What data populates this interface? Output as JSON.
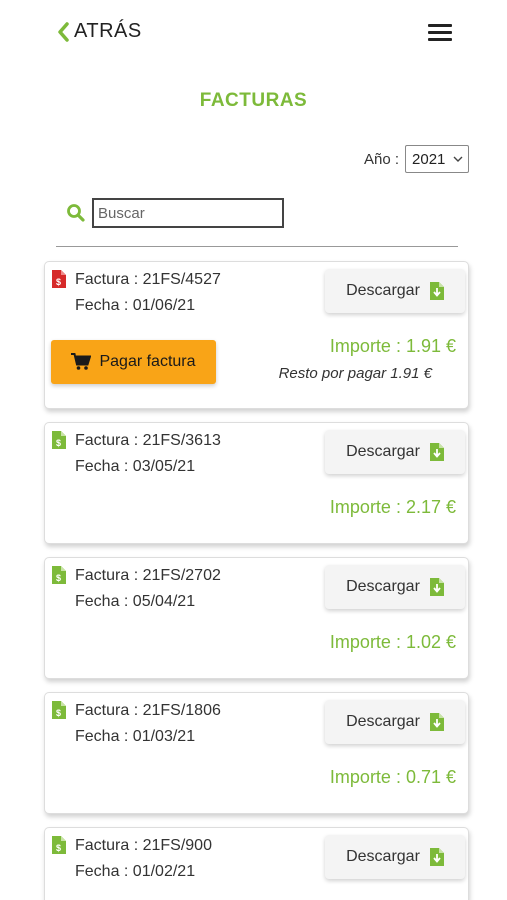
{
  "header": {
    "back_label": "ATRÁS"
  },
  "page_title": "FACTURAS",
  "year_filter": {
    "label": "Año :",
    "selected": "2021"
  },
  "search": {
    "placeholder": "Buscar"
  },
  "colors": {
    "accent_green": "#7dba3a",
    "pay_orange": "#f9a417",
    "unpaid_icon_red": "#d62a2a"
  },
  "invoices": [
    {
      "factura": "Factura : 21FS/4527",
      "fecha": "Fecha : 01/06/21",
      "download_label": "Descargar",
      "importe": "Importe : 1.91 €",
      "status": "unpaid",
      "pay_label": "Pagar factura",
      "resto": "Resto por pagar 1.91 €"
    },
    {
      "factura": "Factura : 21FS/3613",
      "fecha": "Fecha : 03/05/21",
      "download_label": "Descargar",
      "importe": "Importe : 2.17 €",
      "status": "paid"
    },
    {
      "factura": "Factura : 21FS/2702",
      "fecha": "Fecha : 05/04/21",
      "download_label": "Descargar",
      "importe": "Importe : 1.02 €",
      "status": "paid"
    },
    {
      "factura": "Factura : 21FS/1806",
      "fecha": "Fecha : 01/03/21",
      "download_label": "Descargar",
      "importe": "Importe : 0.71 €",
      "status": "paid"
    },
    {
      "factura": "Factura : 21FS/900",
      "fecha": "Fecha : 01/02/21",
      "download_label": "Descargar",
      "status": "paid"
    }
  ]
}
